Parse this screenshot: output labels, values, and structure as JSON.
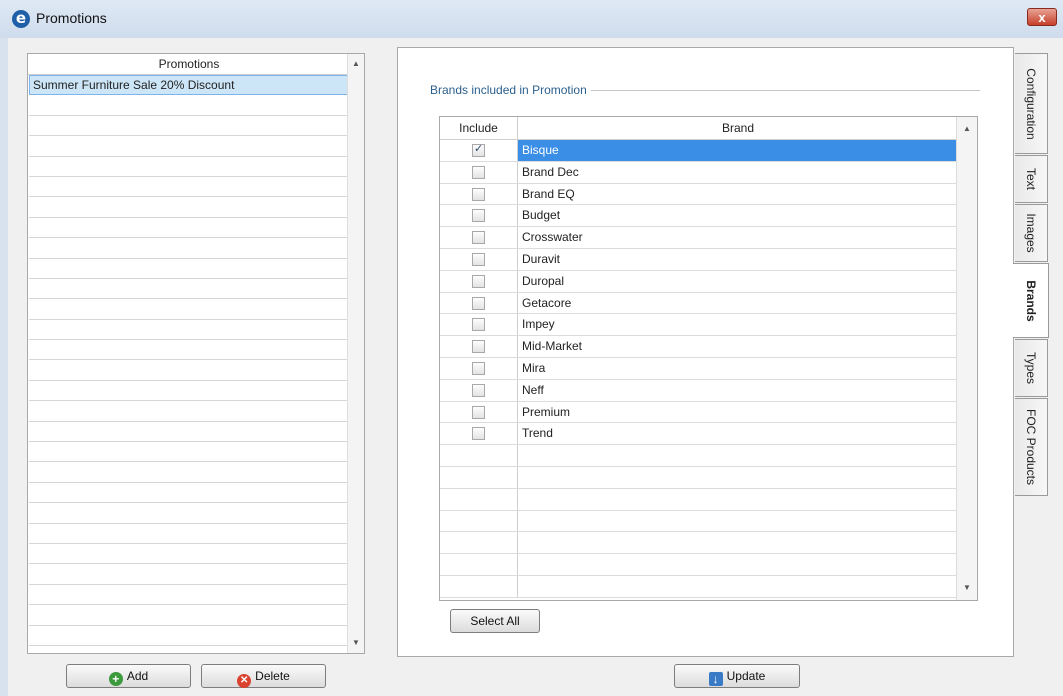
{
  "window": {
    "title": "Promotions",
    "close": "x"
  },
  "promotions": {
    "header": "Promotions",
    "items": [
      "Summer Furniture Sale 20% Discount"
    ],
    "add_label": "Add",
    "delete_label": "Delete"
  },
  "brands": {
    "group_label": "Brands included in Promotion",
    "col_include": "Include",
    "col_brand": "Brand",
    "rows": [
      {
        "name": "Bisque",
        "checked": true,
        "selected": true
      },
      {
        "name": "Brand Dec",
        "checked": false
      },
      {
        "name": "Brand EQ",
        "checked": false
      },
      {
        "name": "Budget",
        "checked": false
      },
      {
        "name": "Crosswater",
        "checked": false
      },
      {
        "name": "Duravit",
        "checked": false
      },
      {
        "name": "Duropal",
        "checked": false
      },
      {
        "name": "Getacore",
        "checked": false
      },
      {
        "name": "Impey",
        "checked": false
      },
      {
        "name": "Mid-Market",
        "checked": false
      },
      {
        "name": "Mira",
        "checked": false
      },
      {
        "name": "Neff",
        "checked": false
      },
      {
        "name": "Premium",
        "checked": false
      },
      {
        "name": "Trend",
        "checked": false
      }
    ],
    "select_all_label": "Select All",
    "update_label": "Update"
  },
  "tabs": [
    {
      "label": "Configuration",
      "active": false
    },
    {
      "label": "Text",
      "active": false
    },
    {
      "label": "Images",
      "active": false
    },
    {
      "label": "Brands",
      "active": true
    },
    {
      "label": "Types",
      "active": false
    },
    {
      "label": "FOC Products",
      "active": false
    }
  ],
  "colors": {
    "selection": "#3a8ee6",
    "list_selection": "#cde6f7",
    "group_label": "#2b5f8c"
  }
}
